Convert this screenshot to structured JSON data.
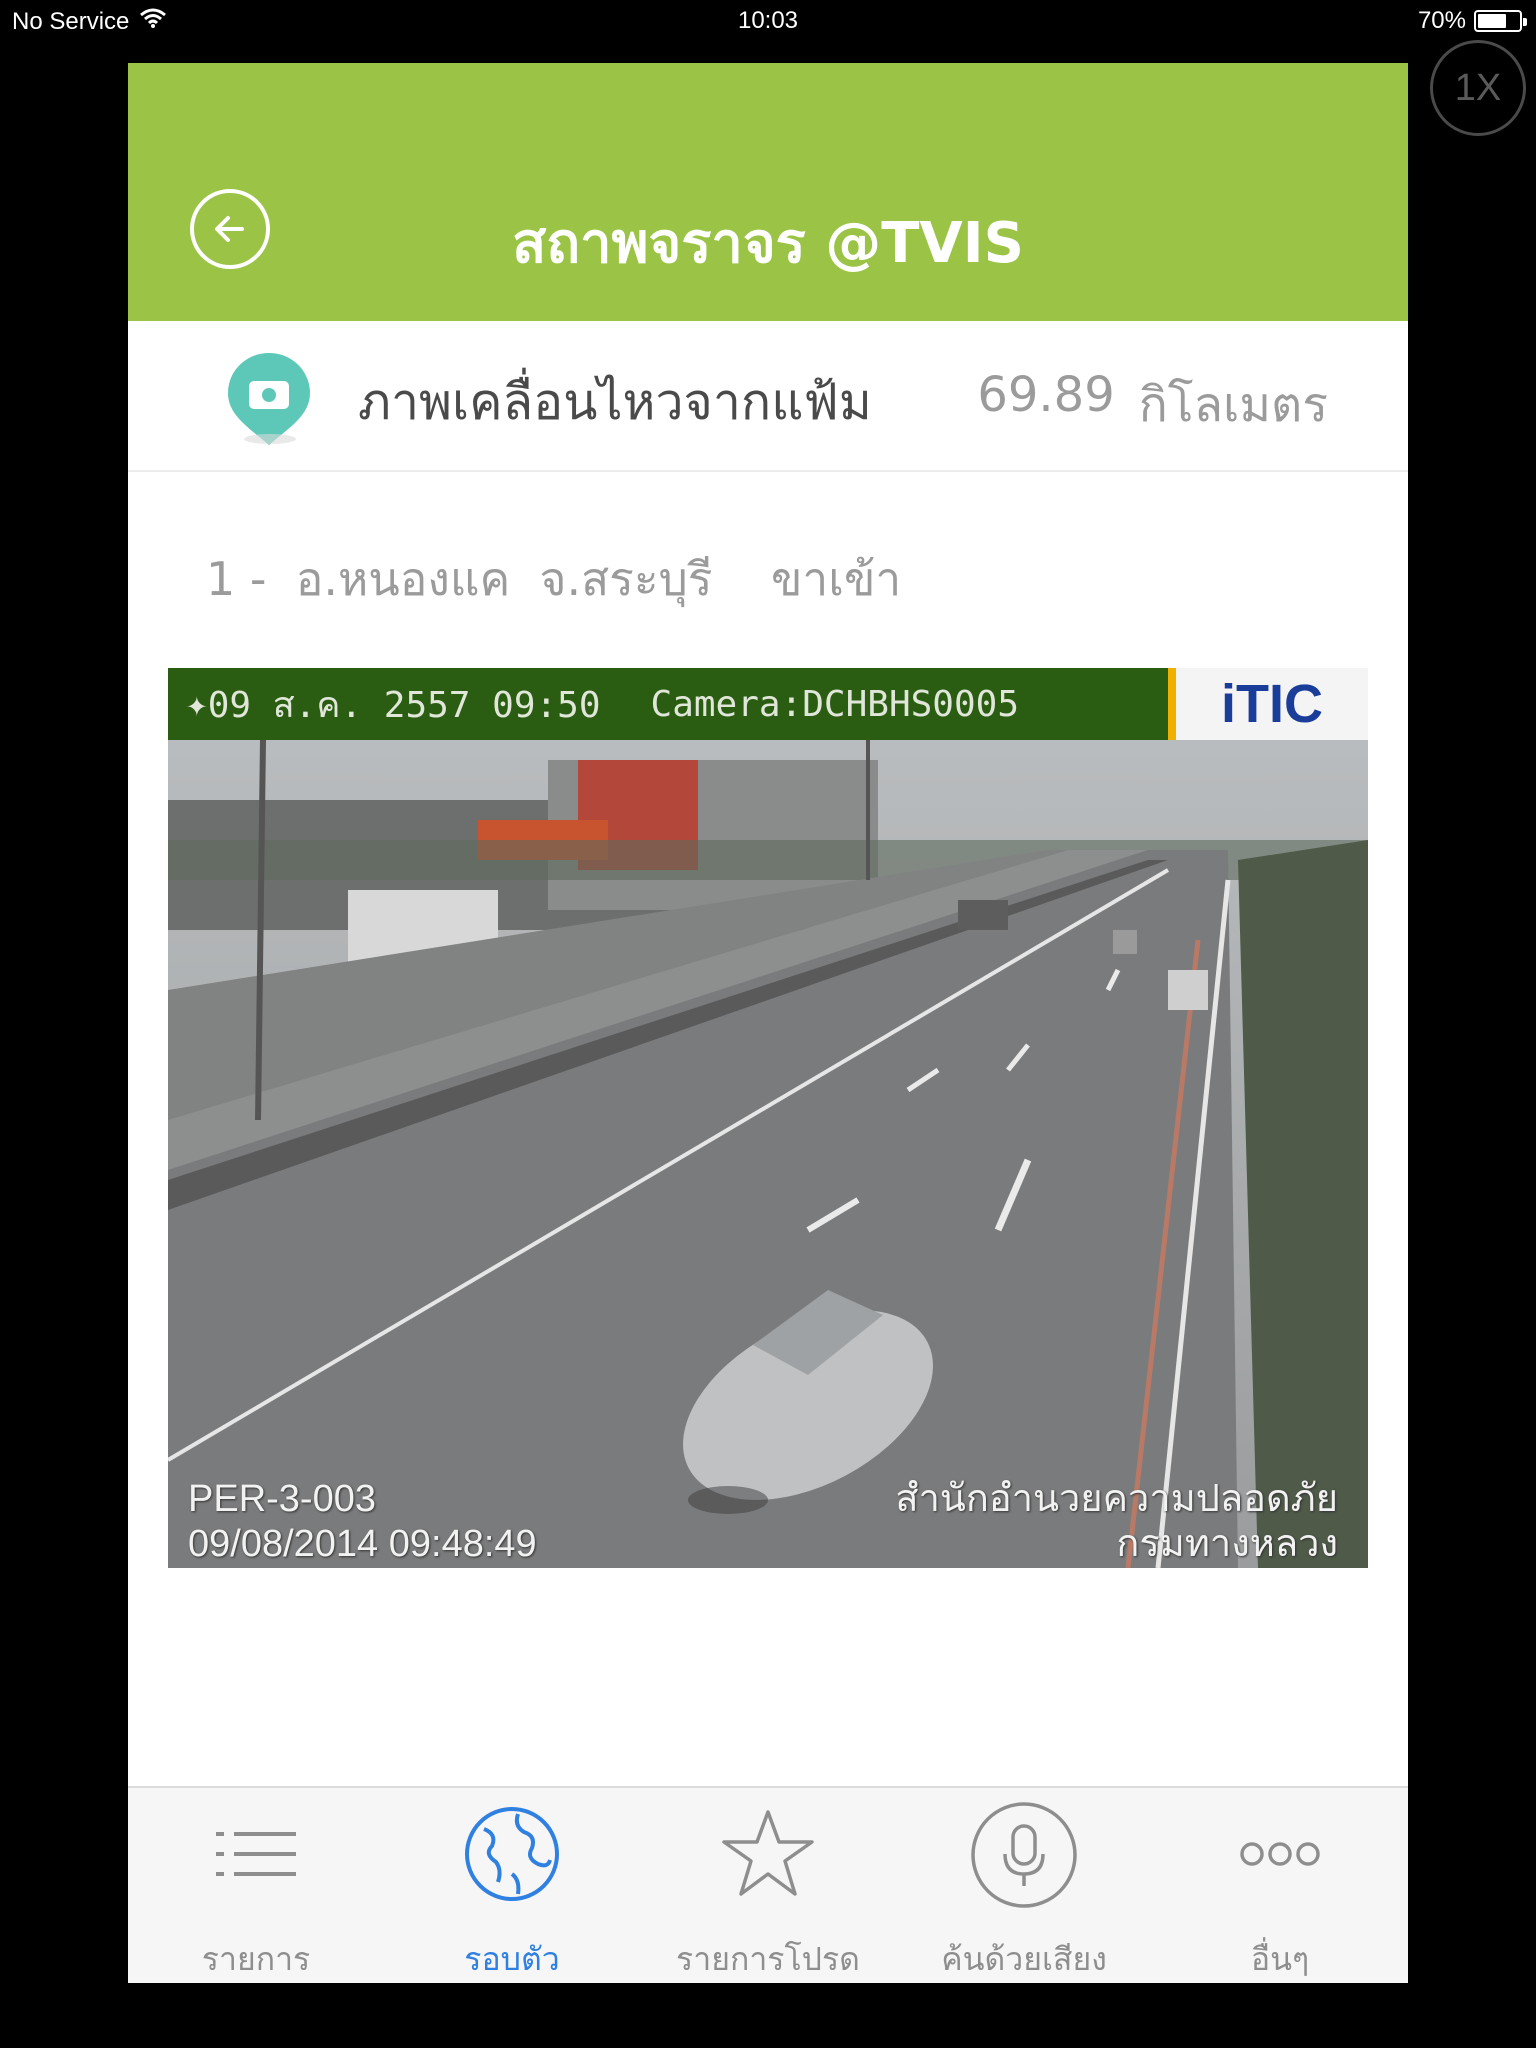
{
  "status_bar": {
    "carrier": "No Service",
    "time": "10:03",
    "battery": "70%",
    "battery_level": 0.7
  },
  "zoom_button": {
    "label": "1X"
  },
  "nav": {
    "title": "สถาพจราจร @TVIS"
  },
  "info": {
    "title": "ภาพเคลื่อนไหวจากแฟ้ม",
    "distance_value": "69.89",
    "distance_unit": "กิโลเมตร"
  },
  "location": {
    "text": "1 -  อ.หนองแค  จ.สระบุรี    ขาเข้า"
  },
  "camera": {
    "header_date": "09 ส.ค. 2557 09:50",
    "header_camera": "Camera:DCHBHS0005",
    "logo": "iTIC",
    "overlay_id": "PER-3-003",
    "overlay_timestamp": "09/08/2014 09:48:49",
    "overlay_org_line1": "สำนักอำนวยความปลอดภัย",
    "overlay_org_line2": "กรมทางหลวง"
  },
  "tabbar": {
    "tabs": [
      {
        "label": "รายการ",
        "icon": "list-icon",
        "active": false
      },
      {
        "label": "รอบตัว",
        "icon": "globe-icon",
        "active": true
      },
      {
        "label": "รายการโปรด",
        "icon": "star-icon",
        "active": false
      },
      {
        "label": "ค้นด้วยเสียง",
        "icon": "microphone-icon",
        "active": false
      },
      {
        "label": "อื่นๆ",
        "icon": "more-icon",
        "active": false
      }
    ]
  },
  "colors": {
    "nav_green": "#9bc446",
    "active_tab": "#2f80e0",
    "pin_teal": "#5ec8b8"
  }
}
